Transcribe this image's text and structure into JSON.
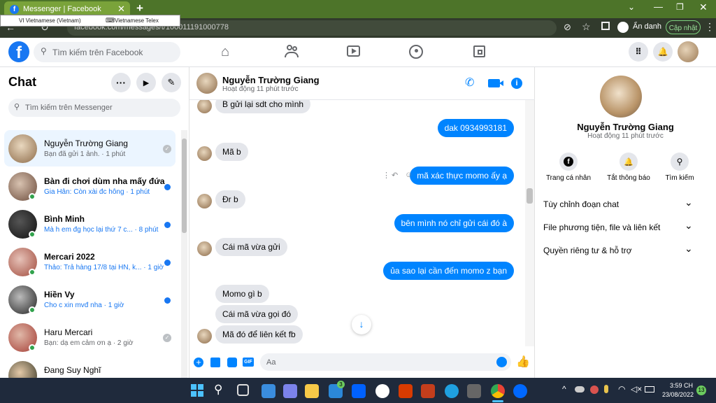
{
  "browser": {
    "tab_title": "Messenger | Facebook",
    "url": "facebook.com/messages/t/100011191000778",
    "profile_label": "Ẩn danh",
    "update_label": "Cập nhật",
    "lang_input": "VI Vietnamese (Vietnam)",
    "lang_method": "Vietnamese Telex"
  },
  "header": {
    "search_placeholder": "Tìm kiếm trên Facebook"
  },
  "sidebar": {
    "title": "Chat",
    "search_placeholder": "Tìm kiếm trên Messenger",
    "conversations": [
      {
        "name": "Nguyễn Trường Giang",
        "preview": "Bạn đã gửi 1 ảnh. · 1 phút",
        "unread": false,
        "online": false,
        "selected": true
      },
      {
        "name": "Bàn đi chơi dùm nha mấy đứa",
        "preview": "Gia Hân: Còn xài đc hông · 1 phút",
        "unread": true,
        "online": true
      },
      {
        "name": "Bình Minh",
        "preview": "Mà h em đg học lại thứ 7 c... · 8 phút",
        "unread": true,
        "online": true
      },
      {
        "name": "Mercari 2022",
        "preview": "Thảo: Trả hàng 17/8 tại HN, k... · 1 giờ",
        "unread": true,
        "online": true
      },
      {
        "name": "Hiền Vy",
        "preview": "Cho c xin mvđ nha · 1 giờ",
        "unread": true,
        "online": true
      },
      {
        "name": "Haru Mercari",
        "preview": "Bạn: dạ em cảm ơn ạ · 2 giờ",
        "unread": false,
        "online": true
      },
      {
        "name": "Đang Suy Nghĩ",
        "preview": "",
        "unread": false,
        "online": false
      }
    ]
  },
  "chat": {
    "name": "Nguyễn Trường Giang",
    "status": "Hoạt động 11 phút trước",
    "composer_placeholder": "Aa",
    "messages": [
      {
        "side": "in",
        "text": "B gửi lại sdt cho mình"
      },
      {
        "side": "out",
        "text": "dak 0934993181"
      },
      {
        "side": "in",
        "text": "Mã b"
      },
      {
        "side": "out",
        "text": "mã xác thực momo ấy ạ"
      },
      {
        "side": "in",
        "text": "Đr b"
      },
      {
        "side": "out",
        "text": "bên mình nó chỉ gửi cái đó à"
      },
      {
        "side": "in",
        "text": "Cái mã vừa gửi"
      },
      {
        "side": "out",
        "text": "ủa sao lại cần đến momo z bạn"
      },
      {
        "side": "in",
        "text": "Momo gì b"
      },
      {
        "side": "in",
        "text": "Cái mã vừa gọi đó"
      },
      {
        "side": "in",
        "text": "Mã đó để liên kết fb"
      }
    ]
  },
  "profile": {
    "name": "Nguyễn Trường Giang",
    "status": "Hoạt động 11 phút trước",
    "actions": [
      "Trang cá nhân",
      "Tắt thông báo",
      "Tìm kiếm"
    ],
    "sections": [
      "Tùy chỉnh đoạn chat",
      "File phương tiện, file và liên kết",
      "Quyền riêng tư & hỗ trợ"
    ]
  },
  "taskbar": {
    "time": "3:59 CH",
    "date": "23/08/2022",
    "notif_count": "13",
    "mail_badge": "3"
  },
  "colors": {
    "fb_blue": "#1877f2",
    "messenger_blue": "#0084ff",
    "chrome_green": "#4d7429"
  }
}
